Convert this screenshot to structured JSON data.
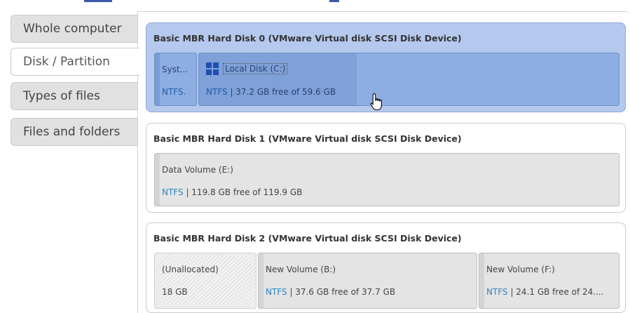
{
  "tabs": [
    {
      "label": "Whole computer",
      "active": false
    },
    {
      "label": "Disk / Partition",
      "active": true
    },
    {
      "label": "Types of files",
      "active": false
    },
    {
      "label": "Files and folders",
      "active": false
    }
  ],
  "disks": [
    {
      "title": "Basic MBR Hard Disk 0 (VMware Virtual disk SCSI Disk Device)",
      "selected": true,
      "partitions": [
        {
          "name": "Syst...",
          "fs": "NTFS."
        },
        {
          "name": "Local Disk (C:)",
          "fs": "NTFS",
          "info": " | 37.2 GB free of 59.6 GB",
          "icon": "windows-icon"
        }
      ]
    },
    {
      "title": "Basic MBR Hard Disk 1 (VMware Virtual disk SCSI Disk Device)",
      "selected": false,
      "partitions": [
        {
          "name": "Data Volume (E:)",
          "fs": "NTFS",
          "info": " | 119.8 GB free of 119.9 GB"
        }
      ]
    },
    {
      "title": "Basic MBR Hard Disk 2 (VMware Virtual disk SCSI Disk Device)",
      "selected": false,
      "partitions": [
        {
          "name": "(Unallocated)",
          "info": "18 GB"
        },
        {
          "name": "New Volume (B:)",
          "fs": "NTFS",
          "info": " | 37.6 GB free of 37.7 GB"
        },
        {
          "name": "New Volume (F:)",
          "fs": "NTFS",
          "info": " | 24.1 GB free of 24...."
        }
      ]
    }
  ],
  "colors": {
    "selected_disk_bg": "#b5c9ee",
    "selected_partition_bg": "#8eaee3",
    "fs_link": "#2f86c2",
    "tab_bg": "#e1e1e1"
  },
  "cursor_icon": "hand-pointer-icon"
}
